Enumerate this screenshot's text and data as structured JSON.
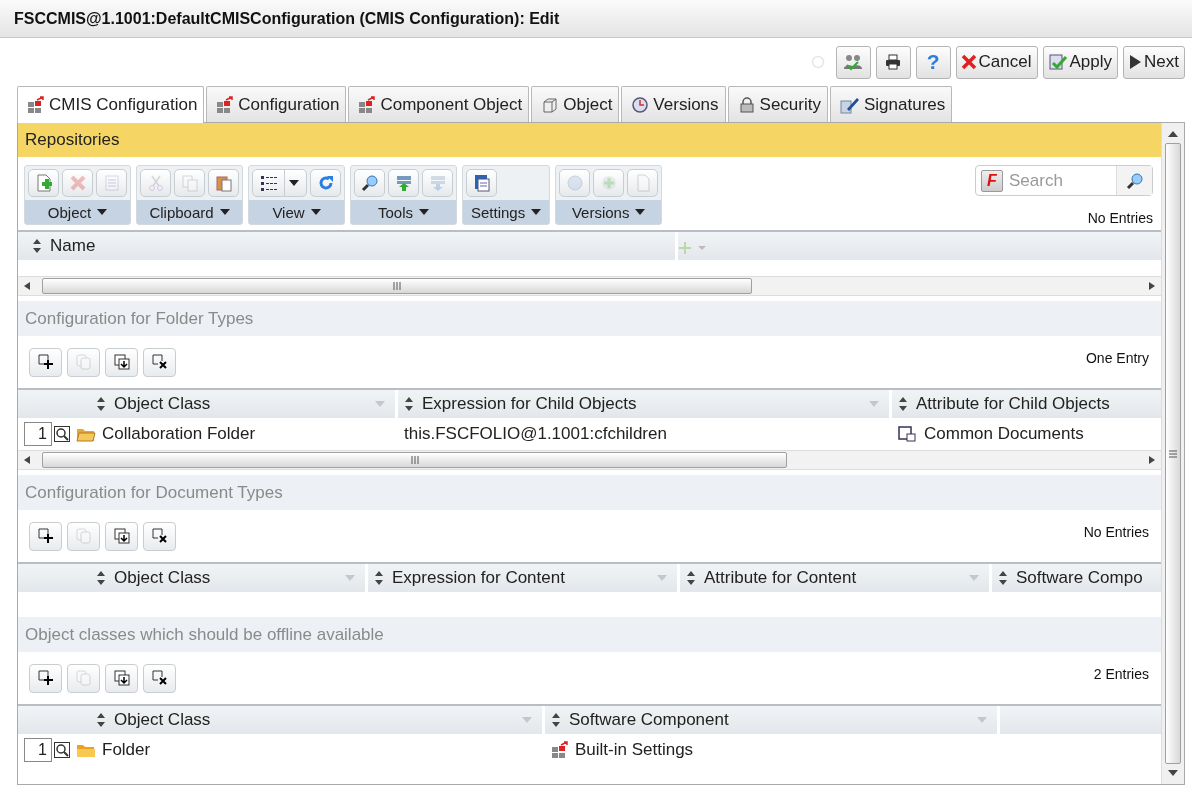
{
  "window": {
    "title": "FSCCMIS@1.1001:DefaultCMISConfiguration (CMIS Configuration): Edit"
  },
  "actions": [
    {
      "kind": "icon",
      "disabled": true
    },
    {
      "kind": "icon",
      "disabled": false
    },
    {
      "kind": "icon",
      "disabled": false
    },
    {
      "kind": "glyph",
      "label": "?"
    },
    {
      "kind": "text",
      "label": "Cancel"
    },
    {
      "kind": "text",
      "label": "Apply"
    },
    {
      "kind": "text",
      "label": "Next"
    }
  ],
  "tabs": [
    {
      "label": "CMIS Configuration",
      "selected": true
    },
    {
      "label": "Configuration",
      "selected": false
    },
    {
      "label": "Component Object",
      "selected": false
    },
    {
      "label": "Object",
      "selected": false
    },
    {
      "label": "Versions",
      "selected": false
    },
    {
      "label": "Security",
      "selected": false
    },
    {
      "label": "Signatures",
      "selected": false
    }
  ],
  "repositories": {
    "title": "Repositories",
    "toolbar": [
      {
        "label": "Object",
        "buttons": [
          {
            "disabled": false
          },
          {
            "disabled": true
          },
          {
            "disabled": true
          }
        ]
      },
      {
        "label": "Clipboard",
        "buttons": [
          {
            "disabled": true
          },
          {
            "disabled": true
          },
          {
            "disabled": false
          }
        ]
      },
      {
        "label": "View",
        "buttons": [
          {
            "disabled": false
          },
          {
            "disabled": false
          }
        ]
      },
      {
        "label": "Tools",
        "buttons": [
          {
            "disabled": false
          },
          {
            "disabled": false
          },
          {
            "disabled": true
          }
        ]
      },
      {
        "label": "Settings",
        "buttons": [
          {
            "disabled": false
          }
        ]
      },
      {
        "label": "Versions",
        "buttons": [
          {
            "disabled": true
          },
          {
            "disabled": true
          },
          {
            "disabled": true
          }
        ]
      }
    ],
    "search": {
      "logo": "F",
      "placeholder": "Search"
    },
    "count": "No Entries",
    "columns": [
      "Name"
    ]
  },
  "sections": [
    {
      "title": "Configuration for Folder Types",
      "count": "One Entry",
      "tools": [
        {
          "disabled": false
        },
        {
          "disabled": true
        },
        {
          "disabled": false
        },
        {
          "disabled": false
        }
      ],
      "columns": [
        "Object Class",
        "Expression for Child Objects",
        "Attribute for Child Objects"
      ],
      "rows": [
        {
          "number": "1",
          "cells": [
            "Collaboration Folder",
            "this.FSCFOLIO@1.1001:cfchildren",
            "Common Documents"
          ]
        }
      ]
    },
    {
      "title": "Configuration for Document Types",
      "count": "No Entries",
      "tools": [
        {
          "disabled": false
        },
        {
          "disabled": true
        },
        {
          "disabled": false
        },
        {
          "disabled": false
        }
      ],
      "columns": [
        "Object Class",
        "Expression for Content",
        "Attribute for Content",
        "Software Compo"
      ]
    },
    {
      "title": "Object classes which should be offline available",
      "count": "2 Entries",
      "tools": [
        {
          "disabled": false
        },
        {
          "disabled": true
        },
        {
          "disabled": false
        },
        {
          "disabled": false
        }
      ],
      "columns": [
        "Object Class",
        "Software Component"
      ],
      "rows": [
        {
          "number": "1",
          "cells": [
            "Folder",
            "Built-in Settings"
          ]
        }
      ]
    }
  ]
}
